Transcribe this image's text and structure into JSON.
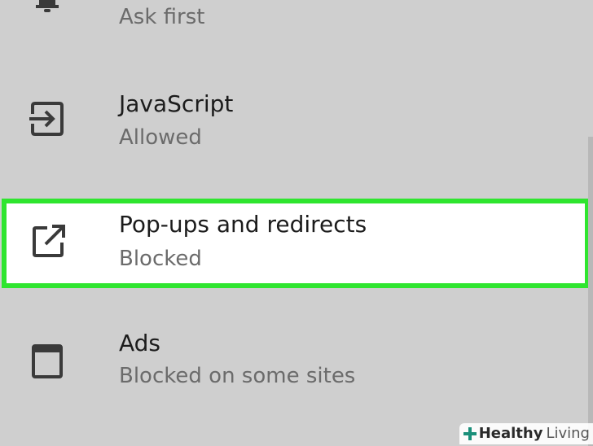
{
  "rows": {
    "notifications": {
      "subtitle": "Ask first",
      "icon": "bell-icon"
    },
    "javascript": {
      "title": "JavaScript",
      "subtitle": "Allowed",
      "icon": "javascript-icon"
    },
    "popups": {
      "title": "Pop-ups and redirects",
      "subtitle": "Blocked",
      "icon": "open-in-new-icon",
      "highlighted": true
    },
    "ads": {
      "title": "Ads",
      "subtitle": "Blocked on some sites",
      "icon": "window-icon"
    }
  },
  "watermark": {
    "brand_bold": "Healthy",
    "brand_light": "Living",
    "icon": "plus-icon"
  },
  "colors": {
    "background": "#cfcfcf",
    "highlight_border": "#2fe52f",
    "highlight_fill": "#ffffff",
    "title_text": "#1c1c1c",
    "subtitle_text": "#6b6b6b",
    "icon": "#3a3a3a",
    "watermark_plus": "#1a8f7a"
  }
}
